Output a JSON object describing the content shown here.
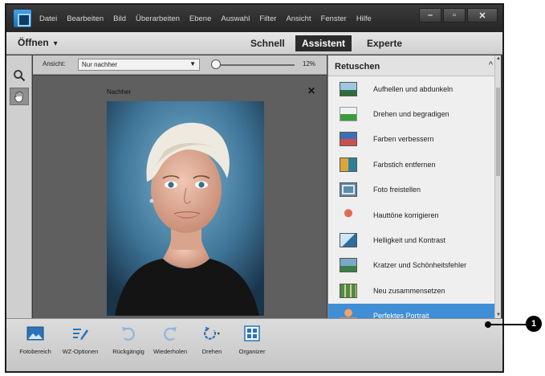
{
  "menu": {
    "items": [
      "Datei",
      "Bearbeiten",
      "Bild",
      "Überarbeiten",
      "Ebene",
      "Auswahl",
      "Filter",
      "Ansicht",
      "Fenster",
      "Hilfe"
    ],
    "minimize": "–",
    "maximize": "▫",
    "close": "✕"
  },
  "modebar": {
    "open_label": "Öffnen",
    "open_caret": "▾",
    "tabs": [
      {
        "label": "Schnell",
        "active": false
      },
      {
        "label": "Assistent",
        "active": true
      },
      {
        "label": "Experte",
        "active": false
      }
    ]
  },
  "tools": [
    {
      "icon": "zoom-icon",
      "selected": false
    },
    {
      "icon": "hand-icon",
      "selected": true
    }
  ],
  "options": {
    "view_label": "Ansicht:",
    "view_value": "Nur nachher",
    "zoom_value": "12%"
  },
  "canvas": {
    "label": "Nachher",
    "close": "✕"
  },
  "panel": {
    "title": "Retuschen",
    "collapse_icon": "chevron-up-icon",
    "items": [
      {
        "label": "Aufhellen und abdunkeln",
        "icon": "landscape-icon",
        "active": false
      },
      {
        "label": "Drehen und begradigen",
        "icon": "rotate-image-icon",
        "active": false
      },
      {
        "label": "Farben verbessern",
        "icon": "color-image-icon",
        "active": false
      },
      {
        "label": "Farbstich entfernen",
        "icon": "colorcast-icon",
        "active": false
      },
      {
        "label": "Foto freistellen",
        "icon": "crop-image-icon",
        "active": false
      },
      {
        "label": "Hauttöne korrigieren",
        "icon": "skin-tone-icon",
        "active": false
      },
      {
        "label": "Helligkeit und Kontrast",
        "icon": "brightness-icon",
        "active": false
      },
      {
        "label": "Kratzer und Schönheitsfehler",
        "icon": "scratch-icon",
        "active": false
      },
      {
        "label": "Neu zusammensetzen",
        "icon": "recompose-icon",
        "active": false
      },
      {
        "label": "Perfektes Portrait",
        "icon": "portrait-icon",
        "active": true
      }
    ]
  },
  "bottombar": {
    "items": [
      {
        "label": "Fotobereich",
        "icon": "photo-bin-icon"
      },
      {
        "label": "WZ-Optionen",
        "icon": "tool-options-icon"
      },
      {
        "label": "Rückgängig",
        "icon": "undo-icon"
      },
      {
        "label": "Wiederholen",
        "icon": "redo-icon"
      },
      {
        "label": "Drehen",
        "icon": "rotate-icon"
      },
      {
        "label": "Organizer",
        "icon": "organizer-icon"
      }
    ]
  },
  "callout": {
    "number": "1"
  },
  "colors": {
    "accent": "#3f8ed6",
    "menubar": "#2e2e2e",
    "panel": "#efefef"
  }
}
